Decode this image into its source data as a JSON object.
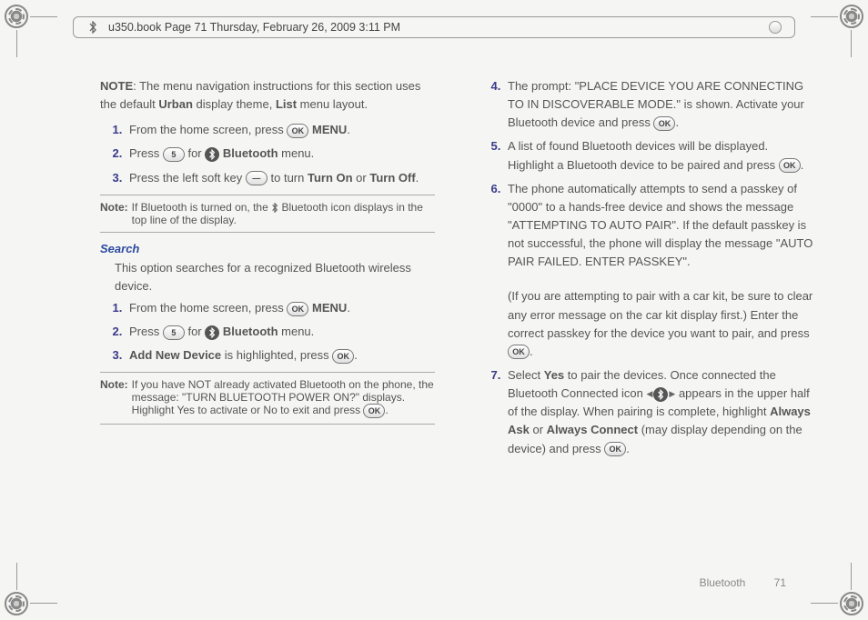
{
  "header": {
    "text": "u350.book  Page 71  Thursday, February 26, 2009  3:11 PM"
  },
  "intro": {
    "note_label": "NOTE",
    "sentence_a": ": The menu navigation instructions for this section uses the default ",
    "urban": "Urban",
    "sentence_b": " display theme, ",
    "list": "List",
    "sentence_c": " menu layout."
  },
  "steps1": {
    "s1a": "From the home screen, press ",
    "s1_key": "OK",
    "s1b": " ",
    "s1_menu": "MENU",
    "s1c": ".",
    "s2a": "Press ",
    "s2_key": "5",
    "s2b": " for ",
    "s2_bt": "Bluetooth",
    "s2c": " menu.",
    "s3a": "Press the left soft key ",
    "s3b": " to turn ",
    "s3_on": "Turn On",
    "s3_or": " or ",
    "s3_off": "Turn Off",
    "s3c": "."
  },
  "note1": {
    "label": "Note:",
    "a": "If Bluetooth is turned on, the ",
    "b": " Bluetooth icon displays in the top line of the display."
  },
  "search": {
    "head": "Search",
    "desc": "This option searches for a recognized Bluetooth wireless device.",
    "s1a": "From the home screen, press ",
    "s1_key": "OK",
    "s1_menu": "MENU",
    "s1b": ".",
    "s2a": "Press ",
    "s2_key": "5",
    "s2b": " for ",
    "s2_bt": "Bluetooth",
    "s2c": " menu.",
    "s3_add": "Add New Device",
    "s3a": " is highlighted, press ",
    "s3_key": "OK",
    "s3b": "."
  },
  "note2": {
    "label": "Note:",
    "a": "If you have NOT already activated Bluetooth on the phone, the message: \"TURN BLUETOOTH POWER ON?\" displays. Highlight Yes to activate or No to exit and press ",
    "key": "OK",
    "b": "."
  },
  "step4": {
    "a": "The prompt: \"PLACE DEVICE YOU ARE CONNECTING TO IN DISCOVERABLE MODE.\" is shown. Activate your Bluetooth device and press ",
    "key": "OK",
    "b": "."
  },
  "step5": {
    "a": "A list of found Bluetooth devices will be displayed. Highlight a Bluetooth device to be paired and press ",
    "key": "OK",
    "b": "."
  },
  "step6": {
    "a": "The phone automatically attempts to send a passkey of \"0000\" to a hands-free device and shows the message \"ATTEMPTING TO AUTO PAIR\". If the default passkey is not successful, the phone will display the message \"AUTO PAIR FAILED. ENTER PASSKEY\".",
    "b1": "(If you are attempting to pair with a car kit, be sure to clear any error message on the car kit display first.) Enter the correct passkey for the device you want to pair, and press ",
    "key": "OK",
    "b2": "."
  },
  "step7": {
    "a": "Select ",
    "yes": "Yes",
    "b": " to pair the devices. Once connected the Bluetooth Connected icon ",
    "c": " appears in the upper half of the display. When pairing is complete, highlight ",
    "ask": "Always Ask",
    "or": " or ",
    "conn": "Always Connect",
    "d": " (may display depending on the device) and press ",
    "key": "OK",
    "e": "."
  },
  "footer": {
    "section": "Bluetooth",
    "page": "71"
  }
}
